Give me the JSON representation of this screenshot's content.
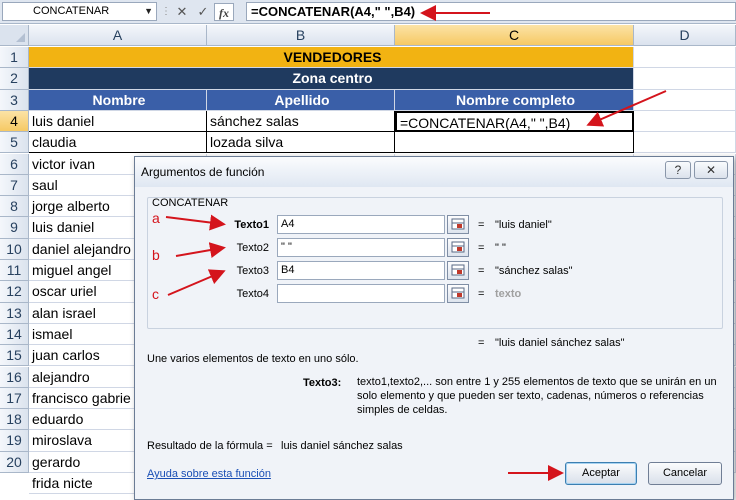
{
  "formula_bar": {
    "name_box": "CONCATENAR",
    "cancel_icon": "✕",
    "enter_icon": "✓",
    "fx_label": "fx",
    "formula": "=CONCATENAR(A4,\" \",B4)"
  },
  "columns": [
    "A",
    "B",
    "C",
    "D"
  ],
  "rows": [
    "1",
    "2",
    "3",
    "4",
    "5",
    "6",
    "7",
    "8",
    "9",
    "10",
    "11",
    "12",
    "13",
    "14",
    "15",
    "16",
    "17",
    "18",
    "19",
    "20"
  ],
  "sheet": {
    "title": "VENDEDORES",
    "subtitle": "Zona centro",
    "headers": [
      "Nombre",
      "Apellido",
      "Nombre completo"
    ],
    "active_cell_text": "=CONCATENAR(A4,\" \",B4)",
    "first_names": [
      "luis daniel",
      "claudia",
      "victor ivan",
      "saul",
      "jorge alberto",
      "luis daniel",
      "daniel alejandro",
      "miguel angel",
      "oscar uriel",
      "alan israel",
      "ismael",
      "juan carlos",
      "alejandro",
      "francisco gabrie",
      "eduardo",
      "miroslava",
      "gerardo",
      "frida nicte"
    ],
    "last_names": [
      "sánchez salas",
      "lozada silva"
    ]
  },
  "dialog": {
    "title": "Argumentos de función",
    "help_label": "?",
    "close_label": "✕",
    "function_name": "CONCATENAR",
    "args": [
      {
        "label": "Texto1",
        "value": "A4",
        "result": "\"luis daniel\""
      },
      {
        "label": "Texto2",
        "value": "\" \"",
        "result": "\" \""
      },
      {
        "label": "Texto3",
        "value": "B4",
        "result": "\"sánchez salas\""
      },
      {
        "label": "Texto4",
        "value": "",
        "result": "texto"
      }
    ],
    "equals": "=",
    "total_result": "\"luis daniel sánchez salas\"",
    "description": "Une varios elementos de texto en uno sólo.",
    "param_name": "Texto3:",
    "param_description": "texto1,texto2,... son entre 1 y 255 elementos de texto que se unirán en un solo elemento y que pueden ser texto, cadenas, números o referencias simples de celdas.",
    "formula_result_label": "Resultado de la fórmula =",
    "formula_result_value": "luis daniel sánchez salas",
    "help_link": "Ayuda sobre esta función",
    "ok_label": "Aceptar",
    "cancel_label": "Cancelar"
  },
  "annotations": {
    "a": "a",
    "b": "b",
    "c": "c"
  },
  "colors": {
    "yellow": "#f2b312",
    "navy": "#1f3a5f",
    "header_blue": "#3a5fa8",
    "arrow_red": "#d4141c"
  }
}
